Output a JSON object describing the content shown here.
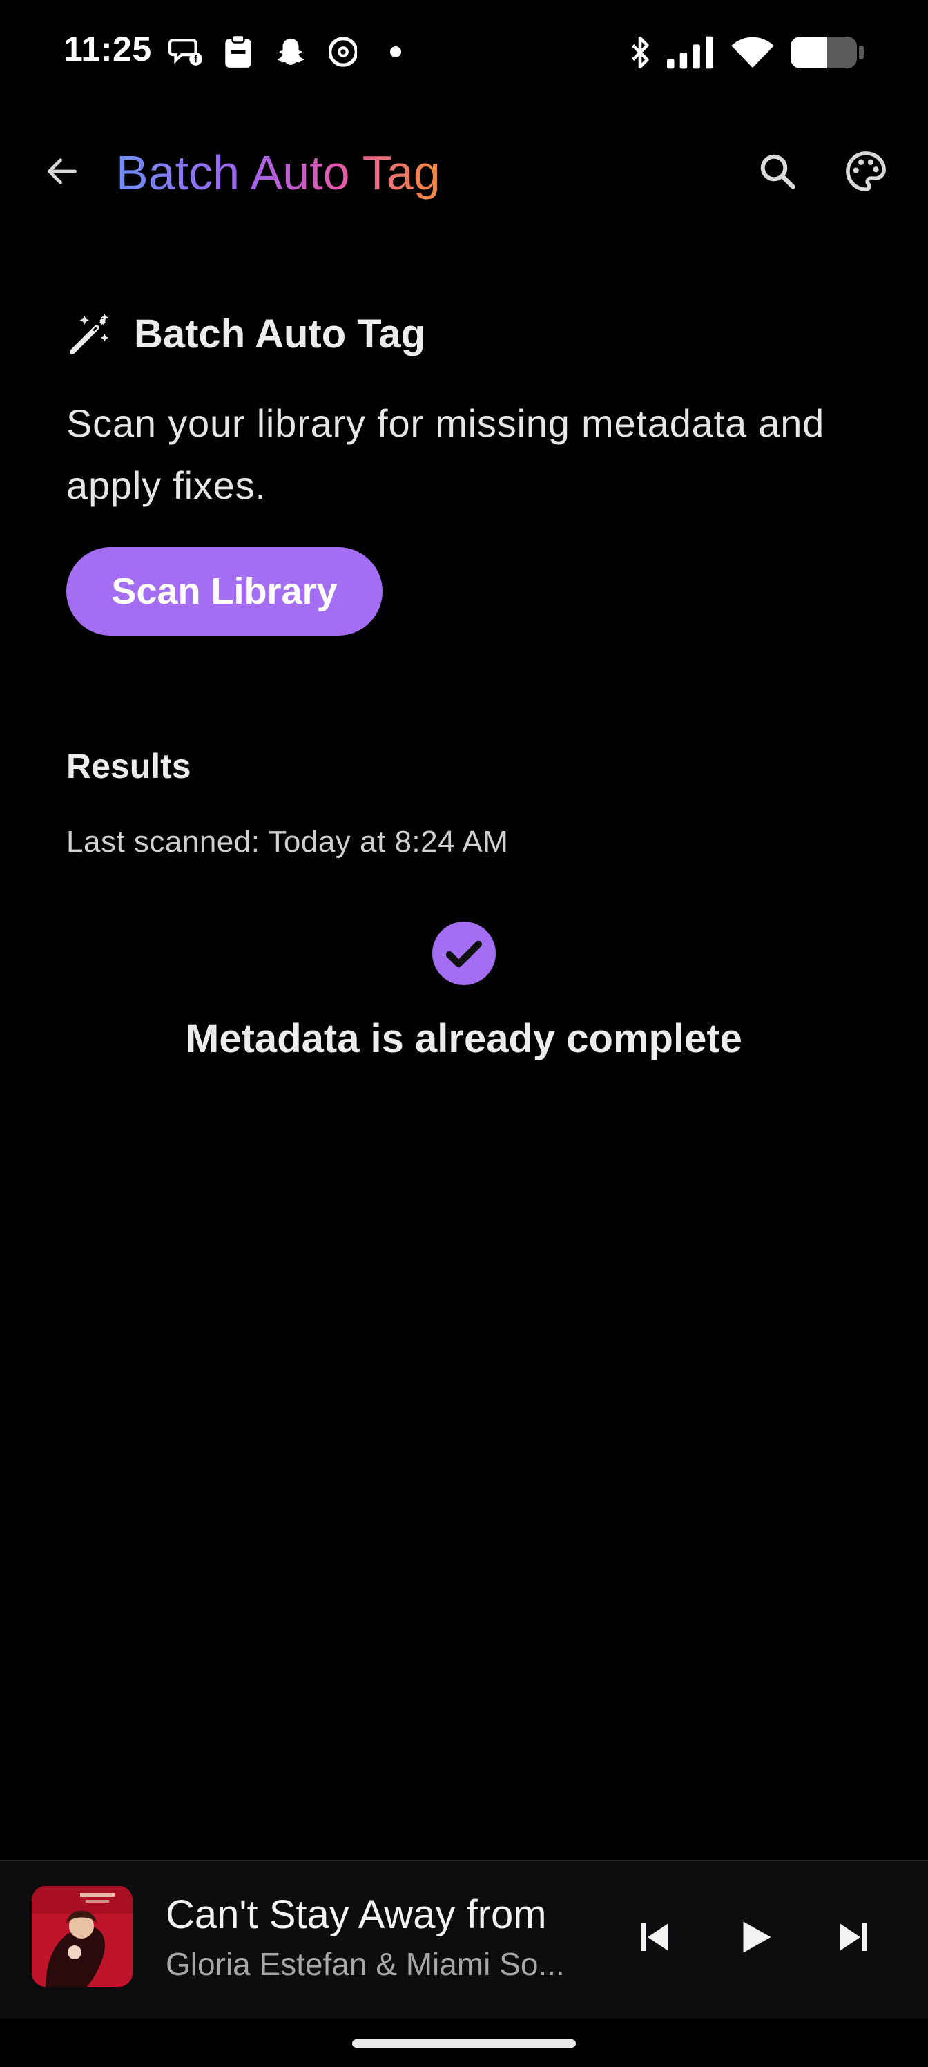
{
  "status_bar": {
    "time": "11:25",
    "left_icons": [
      "messenger-icon",
      "clipboard-icon",
      "snapchat-icon",
      "threads-icon",
      "dot-icon"
    ],
    "right_icons": [
      "bluetooth-icon",
      "signal-icon",
      "wifi-icon",
      "battery-icon"
    ],
    "battery_level": 0.5
  },
  "app_bar": {
    "title": "Batch Auto Tag",
    "title_gradient": [
      "#6f8ff5",
      "#9f63f0",
      "#e85aa6",
      "#f28b3c"
    ]
  },
  "section": {
    "title": "Batch Auto Tag",
    "description": "Scan your library for missing metadata and apply fixes.",
    "scan_button": "Scan Library"
  },
  "results": {
    "title": "Results",
    "last_scanned": "Last scanned: Today at 8:24 AM",
    "message": "Metadata is already complete"
  },
  "mini_player": {
    "track_title": "Can't Stay Away from",
    "artist": "Gloria Estefan & Miami So..."
  },
  "colors": {
    "accent": "#a46ef2",
    "background": "#000000",
    "player_bg": "#0d0d10"
  }
}
